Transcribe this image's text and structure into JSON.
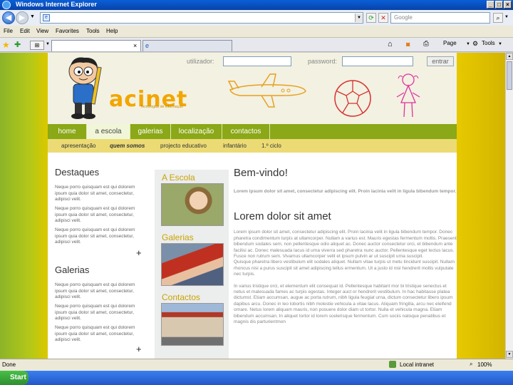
{
  "window": {
    "title": "Windows Internet Explorer"
  },
  "search": {
    "placeholder": "Google"
  },
  "menu": {
    "file": "File",
    "edit": "Edit",
    "view": "View",
    "favorites": "Favorites",
    "tools": "Tools",
    "help": "Help"
  },
  "toolbar": {
    "page": "Page",
    "tools": "Tools"
  },
  "login": {
    "user_label": "utilizador:",
    "pass_label": "password:",
    "button": "entrar"
  },
  "logo": {
    "text": "acinet",
    "tagline": "Tecnologias de Informação"
  },
  "nav": {
    "items": [
      "home",
      "a escola",
      "galerias",
      "localização",
      "contactos"
    ],
    "active": "a escola"
  },
  "subnav": {
    "items": [
      "apresentação",
      "quem somos",
      "projecto educativo",
      "infantário",
      "1.º ciclo"
    ]
  },
  "sidebar": {
    "destaques_title": "Destaques",
    "destaques": [
      "Neque porro quisquam est qui dolorem ipsum quia dolor sit amet, consectetur, adipisci velit.",
      "Neque porro quisquam est qui dolorem ipsum quia dolor sit amet, consectetur, adipisci velit.",
      "Neque porro quisquam est qui dolorem ipsum quia dolor sit amet, consectetur, adipisci velit."
    ],
    "galerias_title": "Galerias",
    "galerias": [
      "Neque porro quisquam est qui dolorem ipsum quia dolor sit amet, consectetur, adipisci velit.",
      "Neque porro quisquam est qui dolorem ipsum quia dolor sit amet, consectetur, adipisci velit.",
      "Neque porro quisquam est qui dolorem ipsum quia dolor sit amet, consectetur, adipisci velit."
    ],
    "plus": "+"
  },
  "middle": {
    "a_escola": "A Escola",
    "galerias": "Galerias",
    "contactos": "Contactos"
  },
  "main": {
    "welcome": "Bem-vindo!",
    "intro": "Lorem ipsum dolor sit amet, consectetur adipiscing elit. Proin lacinia velit in ligula bibendum tempor.",
    "heading": "Lorem dolor sit amet",
    "p1": "Lorem ipsum dolor sit amet, consectetur adipiscing elit. Proin lacinia velit in ligula bibendum tempor. Donec pharetra condimentum turpis at ullamcorper. Nullam a varius est. Mauris egestas fermentum mollis. Praesent bibendum sodales sem, non pellentesque odio aliquet ac. Donec auctor consectetur orci, et bibendum ante facilisi ac. Donec malesuada lacus id urna viverra sed pharetra nunc auctor. Pellentesque eget lectus lacus. Fusce non rutrum sem. Vivamus ullamcorper velit et ipsum pulvin ar ut suscipit urna suscipit.",
    "p2": "Quisque pharetra libero vestibulum elit sodales aliquet. Nullam vitae turpis ut metu tincidunt suscipit. Nullam rhoncus nisi a purus suscipit sit amet adipiscing tellus ermentum. Ut a justo id nisl hendrerit mollis vulputate nec turpis.",
    "p3": "In varius tristique orci, et elementum elit consequat id. Pellentesque habitant mor bi tristique senectus et netus et malesuada fames ac turpis egestas. Integer auct or hendrerit vestibulum. In hac habitasse platea dictumst. Etiam accumsan, augue ac porta rutrum, nibh ligula feugiat urna, dictum consectetur libero ipsum dapibus arcu. Donec in leo lobortis nibh molestie vehicula a vitae lacus. Aliquam fringilla, arcu nec eleifend ornare. Netus lorem aliquam mauris, non posuere dolor diam ut tortor. Nulla et vehicula magna. Etiam bibendum accumsan. In aliquet tortor id lorem scelerisque fermentum. Cum sociis natoque penatibus et magnis dis parturientmon"
  },
  "status": {
    "text": "Done",
    "zone": "Local intranet",
    "zoom": "100%"
  },
  "taskbar": {
    "start": "Start"
  }
}
